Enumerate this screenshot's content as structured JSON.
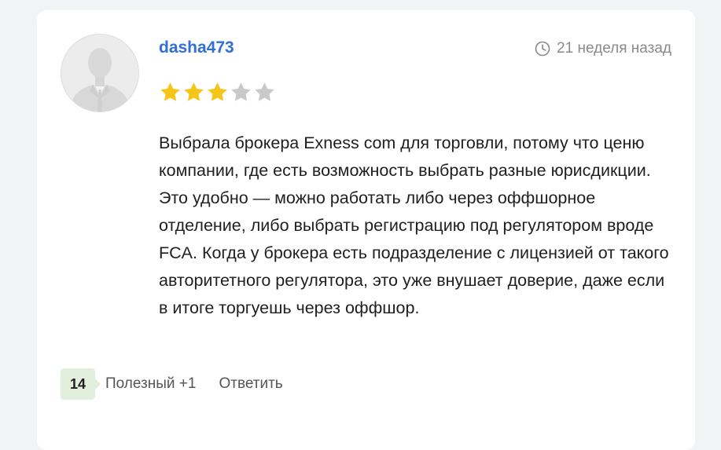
{
  "review": {
    "username": "dasha473",
    "time_ago": "21 неделя назад",
    "rating": 3,
    "rating_max": 5,
    "text": "Выбрала брокера Exness com для торговли, потому что ценю компании, где есть возможность выбрать разные юрисдикции. Это удобно — можно работать либо через оффшорное отделение, либо выбрать регистрацию под регулятором вроде FCA. Когда у брокера есть подразделение с лицензией от такого авторитетного регулятора, это уже внушает доверие, даже если в итоге торгуешь через оффшор.",
    "helpful_count": "14",
    "helpful_label": "Полезный +1",
    "reply_label": "Ответить"
  },
  "icons": {
    "avatar": "user-silhouette-icon",
    "time": "clock-icon",
    "rating": "star-icon"
  },
  "colors": {
    "username": "#2f6fd6",
    "star_filled": "#f5c518",
    "star_empty": "#c9c9c9",
    "badge_bg": "#e3efdd",
    "page_bg": "#f2f3f5"
  }
}
